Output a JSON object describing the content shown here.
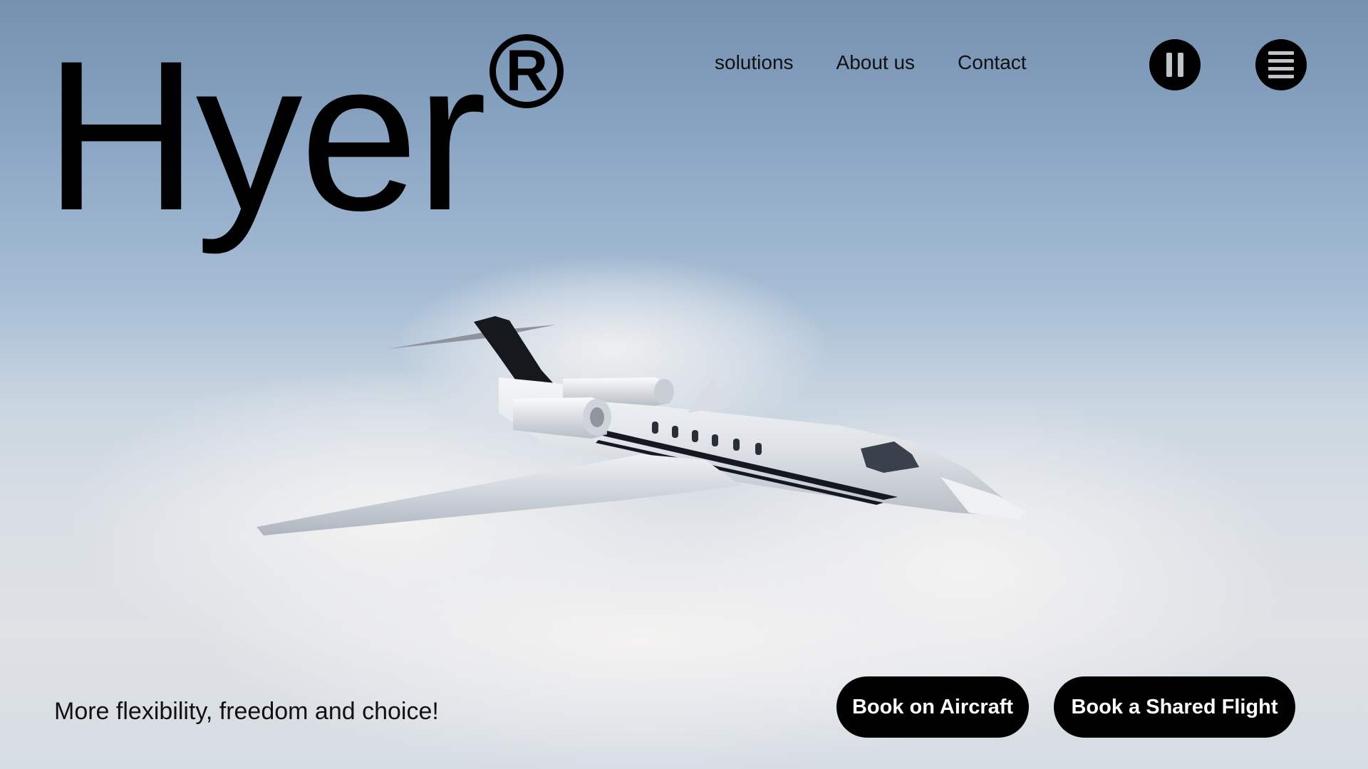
{
  "brand": {
    "name": "Hyer",
    "registered_mark": "R"
  },
  "nav": {
    "items": [
      {
        "label": "solutions"
      },
      {
        "label": "About us"
      },
      {
        "label": "Contact"
      }
    ]
  },
  "controls": {
    "pause_icon": "pause-icon",
    "menu_icon": "hamburger-menu-icon"
  },
  "hero": {
    "tagline": "More flexibility, freedom and choice!",
    "cta_primary": "Book on Aircraft",
    "cta_secondary": "Book a Shared Flight"
  },
  "colors": {
    "sky_top": "#7690b0",
    "sky_bottom": "#dfe1e5",
    "button_bg": "#000000",
    "button_text": "#ffffff"
  }
}
